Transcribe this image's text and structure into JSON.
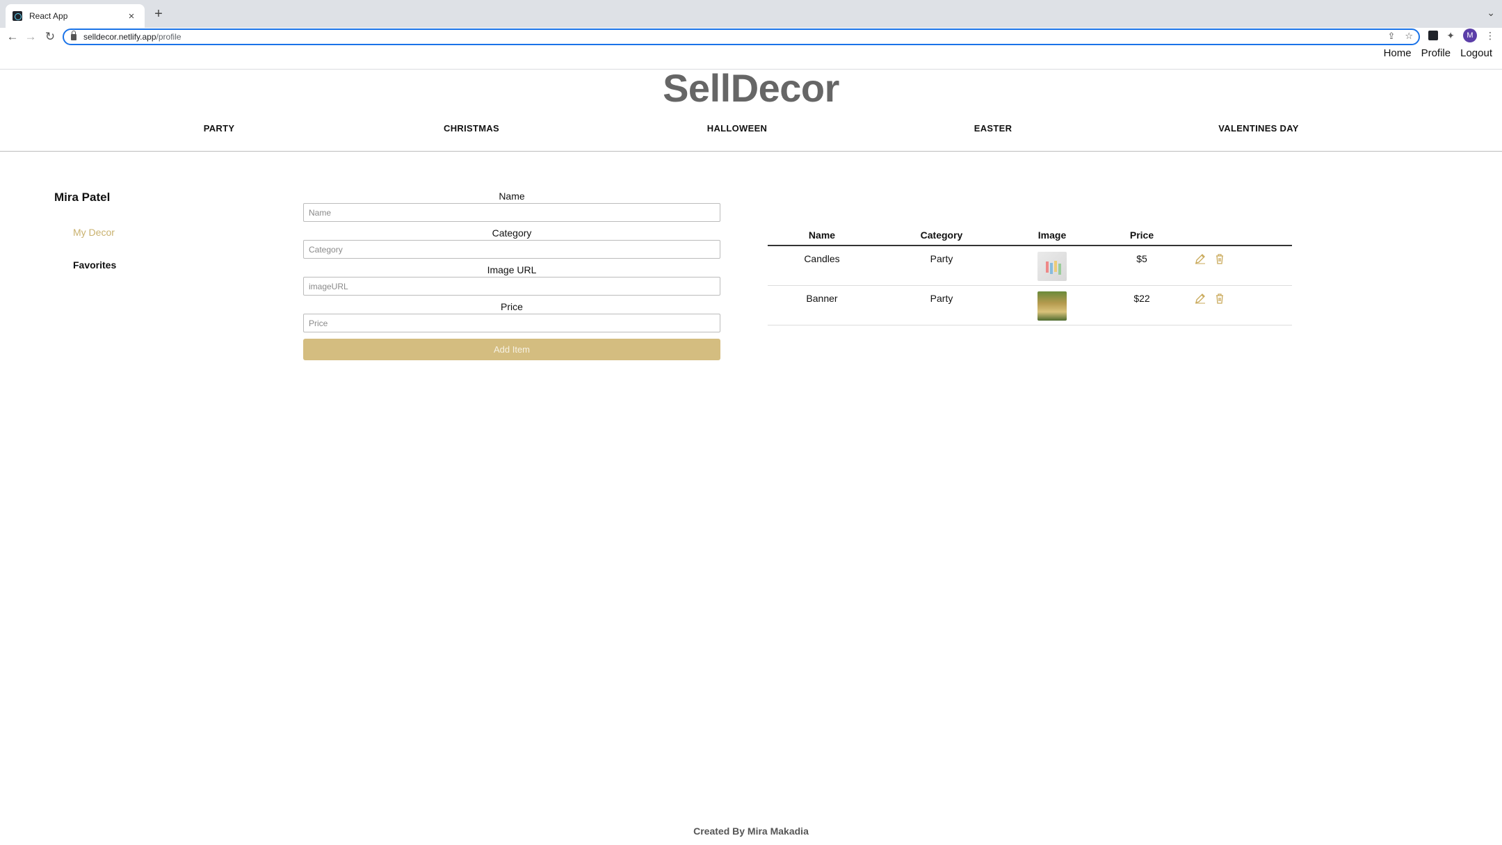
{
  "browser": {
    "tab_title": "React App",
    "tab_close": "×",
    "new_tab": "+",
    "url_host": "selldecor.netlify.app",
    "url_path": "/profile",
    "profile_initial": "M"
  },
  "topnav": {
    "home": "Home",
    "profile": "Profile",
    "logout": "Logout"
  },
  "brand": "SellDecor",
  "categories": [
    "PARTY",
    "CHRISTMAS",
    "HALLOWEEN",
    "EASTER",
    "VALENTINES DAY"
  ],
  "sidebar": {
    "user_name": "Mira Patel",
    "my_decor": "My Decor",
    "favorites": "Favorites"
  },
  "form": {
    "name_label": "Name",
    "name_placeholder": "Name",
    "category_label": "Category",
    "category_placeholder": "Category",
    "image_label": "Image URL",
    "image_placeholder": "imageURL",
    "price_label": "Price",
    "price_placeholder": "Price",
    "submit_label": "Add Item"
  },
  "table": {
    "headers": [
      "Name",
      "Category",
      "Image",
      "Price"
    ],
    "rows": [
      {
        "name": "Candles",
        "category": "Party",
        "price": "$5"
      },
      {
        "name": "Banner",
        "category": "Party",
        "price": "$22"
      }
    ]
  },
  "footer": "Created By Mira Makadia",
  "colors": {
    "accent": "#c9b16e",
    "button": "#d4bd80",
    "brand_text": "#666666"
  }
}
